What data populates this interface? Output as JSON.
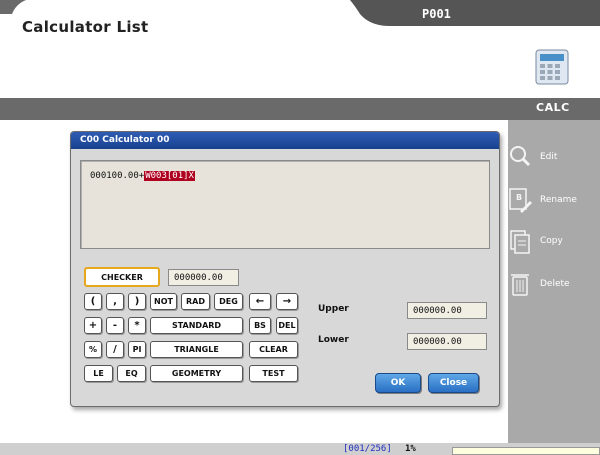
{
  "window": {
    "title": "Calculator List",
    "tab_label": "P001"
  },
  "toolbar": {
    "section_label": "CALC"
  },
  "sidebar": {
    "items": [
      {
        "label": "Edit",
        "icon": "magnifier-icon"
      },
      {
        "label": "Rename",
        "icon": "rename-icon"
      },
      {
        "label": "Copy",
        "icon": "copy-icon"
      },
      {
        "label": "Delete",
        "icon": "trash-icon"
      }
    ]
  },
  "dialog": {
    "title": "C00 Calculator 00",
    "expression_prefix": "000100.00+",
    "expression_highlight": "W003[01]X",
    "checker_label": "CHECKER",
    "checker_value": "000000.00",
    "keys": {
      "open_paren": "(",
      "comma": ",",
      "close_paren": ")",
      "not": "NOT",
      "rad": "RAD",
      "deg": "DEG",
      "left_arrow": "←",
      "right_arrow": "→",
      "plus": "+",
      "minus": "-",
      "multiply": "*",
      "standard": "STANDARD",
      "bs": "BS",
      "del": "DEL",
      "percent": "%",
      "divide": "/",
      "pi": "PI",
      "triangle": "TRIANGLE",
      "clear": "CLEAR",
      "le": "LE",
      "eq": "EQ",
      "geometry": "GEOMETRY",
      "test": "TEST"
    },
    "upper_label": "Upper",
    "upper_value": "000000.00",
    "lower_label": "Lower",
    "lower_value": "000000.00",
    "ok_label": "OK",
    "close_label": "Close"
  },
  "status": {
    "page": "[001/256]",
    "percent": "1%"
  },
  "colors": {
    "accent_blue": "#2a6fc4",
    "highlight_red": "#b00020",
    "checker_orange": "#e6a81c",
    "sidebar_gray": "#a9a9a9",
    "bar_gray": "#6a6a6a"
  }
}
